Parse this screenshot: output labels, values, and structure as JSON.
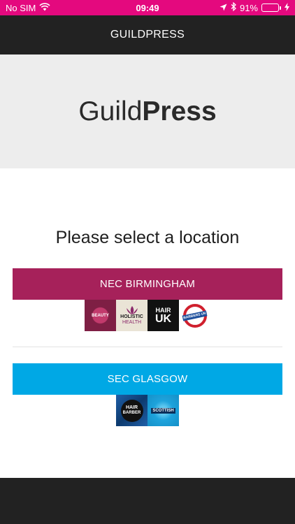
{
  "status_bar": {
    "carrier": "No SIM",
    "time": "09:49",
    "battery_percent": "91%",
    "battery_level": 0.91,
    "battery_color": "#4cd964",
    "background": "#e4097e"
  },
  "nav": {
    "title": "GUILDPRESS"
  },
  "hero": {
    "logo_light": "Guild",
    "logo_bold": "Press"
  },
  "prompt": "Please select a location",
  "locations": [
    {
      "label": "NEC BIRMINGHAM",
      "color": "#a6215a",
      "logos": [
        {
          "name": "beauty-uk-logo",
          "text": "BEAUTY"
        },
        {
          "name": "holistic-health-logo",
          "text_top": "HOLISTIC",
          "text_bottom": "HEALTH"
        },
        {
          "name": "hair-uk-logo",
          "text_top": "HAIR",
          "text_bottom": "UK"
        },
        {
          "name": "barbers-uk-logo",
          "text": "BARBERS UK"
        }
      ]
    },
    {
      "label": "SEC GLASGOW",
      "color": "#00a8e5",
      "logos": [
        {
          "name": "hair-and-barber-logo",
          "text_top": "HAIR",
          "text_bottom": "BARBER"
        },
        {
          "name": "scottish-logo",
          "text": "SCOTTISH"
        }
      ]
    }
  ]
}
